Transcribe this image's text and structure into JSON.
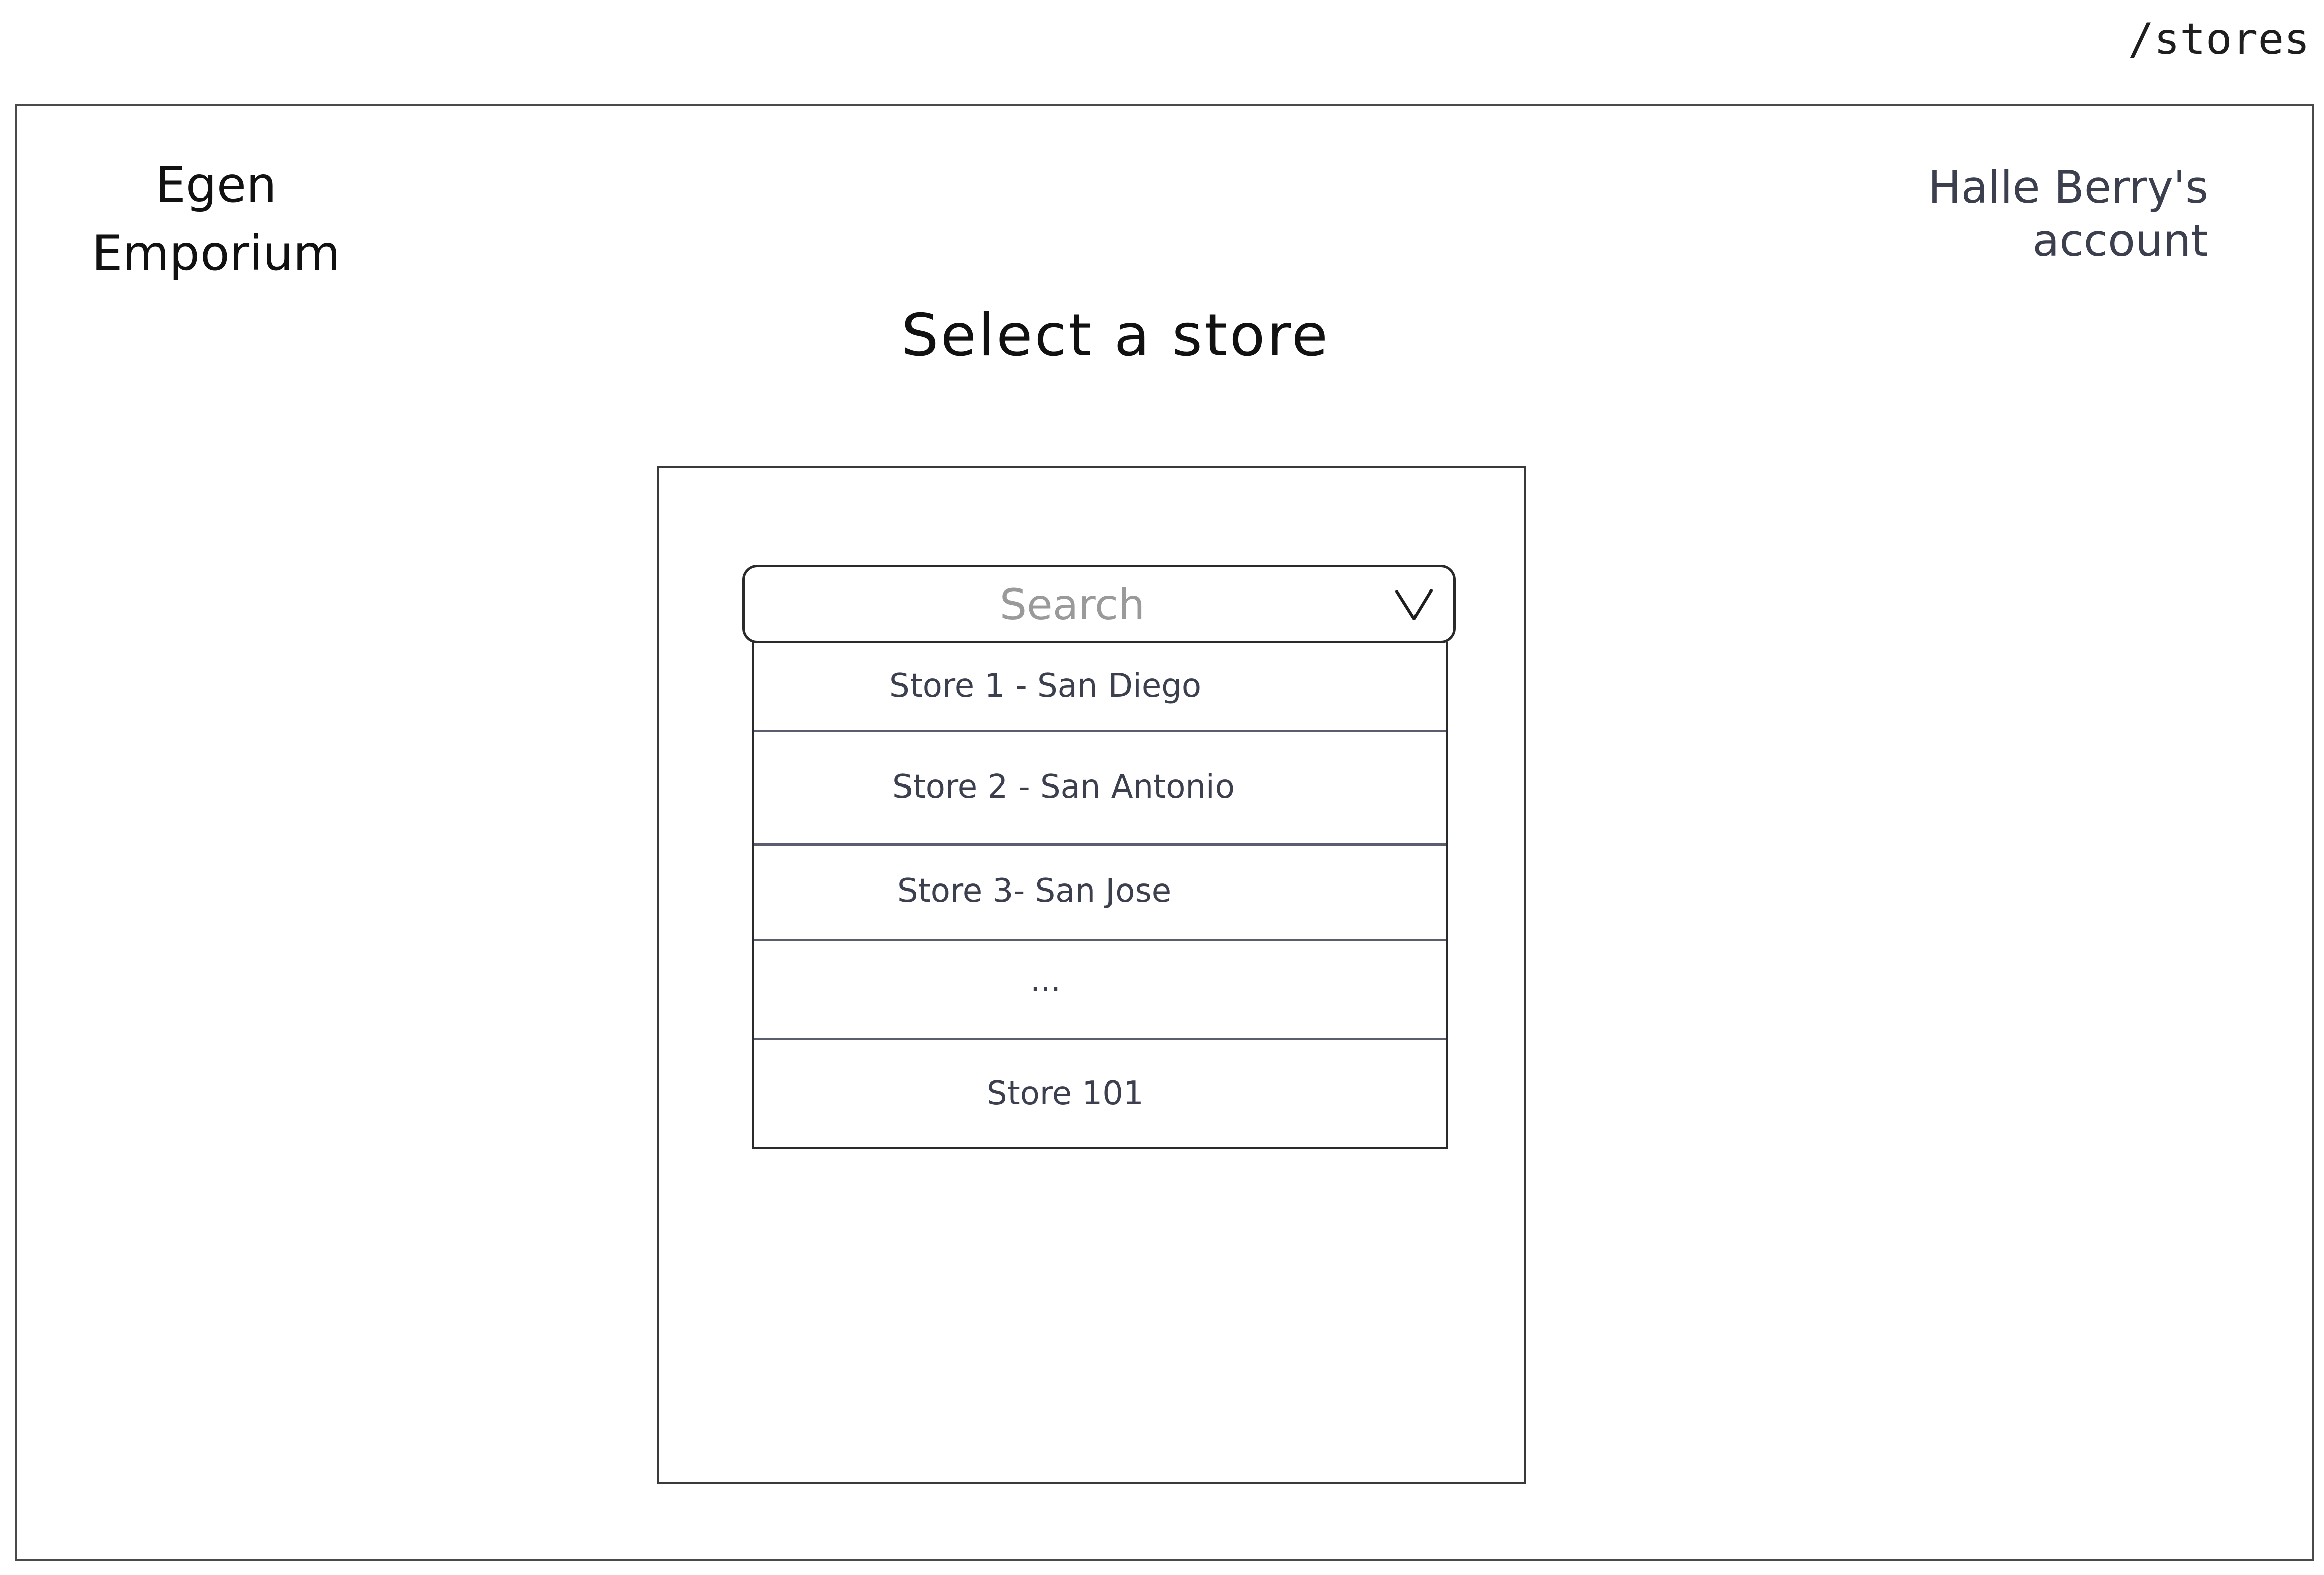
{
  "route": "/stores",
  "header": {
    "brand": "Egen\nEmporium",
    "account": "Halle Berry's\naccount"
  },
  "page": {
    "title": "Select a store"
  },
  "search": {
    "placeholder": "Search",
    "value": "",
    "dropdown_icon": "chevron-down-icon"
  },
  "stores": [
    "Store 1 - San Diego",
    "Store 2 - San Antonio",
    "Store 3- San Jose",
    "...",
    "Store 101"
  ]
}
